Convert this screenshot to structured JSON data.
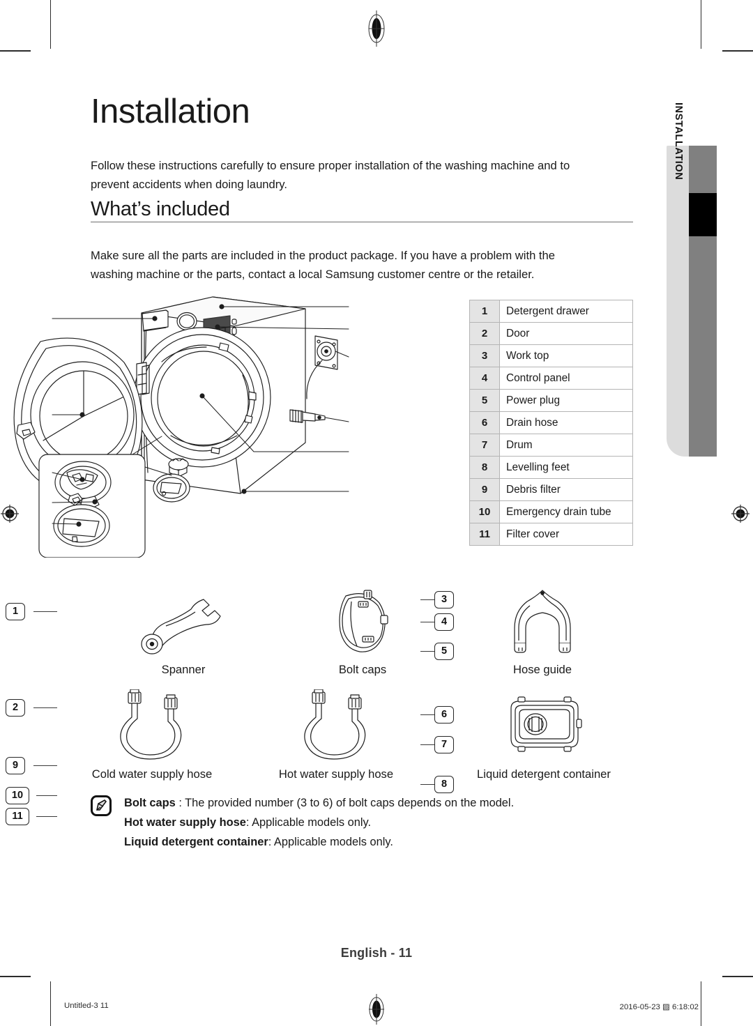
{
  "document": {
    "chapter_title": "Installation",
    "intro": "Follow these instructions carefully to ensure proper installation of the washing machine and to prevent accidents when doing laundry.",
    "section_title": "What’s included",
    "section_lead": "Make sure all the parts are included in the product package. If you have a problem with the washing machine or the parts, contact a local Samsung customer centre or the retailer.",
    "side_tab_label": "INSTALLATION"
  },
  "parts_table": {
    "rows": [
      {
        "num": "1",
        "label": "Detergent drawer"
      },
      {
        "num": "2",
        "label": "Door"
      },
      {
        "num": "3",
        "label": "Work top"
      },
      {
        "num": "4",
        "label": "Control panel"
      },
      {
        "num": "5",
        "label": "Power plug"
      },
      {
        "num": "6",
        "label": "Drain hose"
      },
      {
        "num": "7",
        "label": "Drum"
      },
      {
        "num": "8",
        "label": "Levelling feet"
      },
      {
        "num": "9",
        "label": "Debris filter"
      },
      {
        "num": "10",
        "label": "Emergency drain tube"
      },
      {
        "num": "11",
        "label": "Filter cover"
      }
    ]
  },
  "figure": {
    "callouts": [
      {
        "id": "1",
        "side": "left"
      },
      {
        "id": "2",
        "side": "left"
      },
      {
        "id": "9",
        "side": "left"
      },
      {
        "id": "10",
        "side": "left"
      },
      {
        "id": "11",
        "side": "left"
      },
      {
        "id": "3",
        "side": "right"
      },
      {
        "id": "4",
        "side": "right"
      },
      {
        "id": "5",
        "side": "right"
      },
      {
        "id": "6",
        "side": "right"
      },
      {
        "id": "7",
        "side": "right"
      },
      {
        "id": "8",
        "side": "right"
      }
    ]
  },
  "accessories": {
    "row1": [
      {
        "name": "Spanner",
        "icon": "spanner-icon"
      },
      {
        "name": "Bolt caps",
        "icon": "bolt-cap-icon"
      },
      {
        "name": "Hose guide",
        "icon": "hose-guide-icon"
      }
    ],
    "row2": [
      {
        "name": "Cold water supply hose",
        "icon": "water-hose-icon"
      },
      {
        "name": "Hot water supply hose",
        "icon": "water-hose-icon"
      },
      {
        "name": "Liquid detergent container",
        "icon": "detergent-container-icon"
      }
    ]
  },
  "note": {
    "icon": "note-pencil-icon",
    "lines": [
      {
        "bold": "Bolt caps",
        "rest": " : The provided number (3 to 6) of bolt caps depends on the model."
      },
      {
        "bold": "Hot water supply hose",
        "rest": ": Applicable models only."
      },
      {
        "bold": "Liquid detergent container",
        "rest": ": Applicable models only."
      }
    ]
  },
  "footer": {
    "page_label": "English - 11",
    "sheet_left": "Untitled-3   11",
    "sheet_right": "2016-05-23   ▨ 6:18:02"
  }
}
